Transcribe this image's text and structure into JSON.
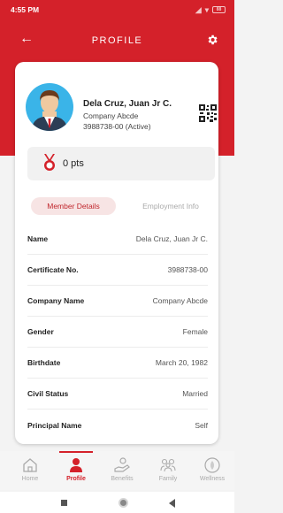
{
  "status_bar": {
    "time": "4:55 PM",
    "battery": "88"
  },
  "header": {
    "title": "PROFILE"
  },
  "member": {
    "name": "Dela Cruz, Juan Jr C.",
    "company": "Company Abcde",
    "certificate": "3988738-00 (Active)"
  },
  "points": {
    "text": "0 pts"
  },
  "tabs": [
    {
      "label": "Member Details",
      "active": true
    },
    {
      "label": "Employment Info",
      "active": false
    }
  ],
  "details": [
    {
      "label": "Name",
      "value": "Dela Cruz, Juan Jr C."
    },
    {
      "label": "Certificate No.",
      "value": "3988738-00"
    },
    {
      "label": "Company Name",
      "value": "Company Abcde"
    },
    {
      "label": "Gender",
      "value": "Female"
    },
    {
      "label": "Birthdate",
      "value": "March 20, 1982"
    },
    {
      "label": "Civil Status",
      "value": "Married"
    },
    {
      "label": "Principal Name",
      "value": "Self"
    }
  ],
  "bottom_nav": [
    {
      "label": "Home",
      "icon": "home-icon",
      "active": false
    },
    {
      "label": "Profile",
      "icon": "profile-icon",
      "active": true
    },
    {
      "label": "Benefits",
      "icon": "benefits-icon",
      "active": false
    },
    {
      "label": "Family",
      "icon": "family-icon",
      "active": false
    },
    {
      "label": "Wellness",
      "icon": "wellness-icon",
      "active": false
    }
  ],
  "colors": {
    "accent": "#d4212a",
    "avatar_bg": "#3ab4e8",
    "tab_active_bg": "#f7e4e4"
  }
}
